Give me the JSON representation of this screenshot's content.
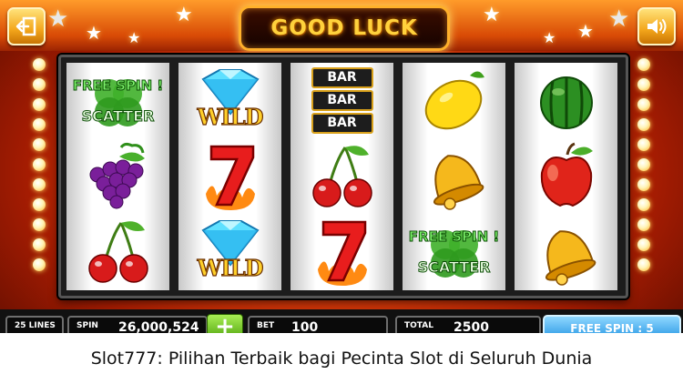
{
  "header": {
    "title": "GOOD LUCK",
    "back_icon": "exit-icon",
    "sound_icon": "speaker-icon"
  },
  "reels": [
    [
      "free-spin-scatter",
      "grapes",
      "cherries"
    ],
    [
      "diamond-wild",
      "seven",
      "diamond-wild"
    ],
    [
      "bar-bar-bar",
      "cherries",
      "seven"
    ],
    [
      "lemon",
      "bell",
      "free-spin-scatter"
    ],
    [
      "watermelon",
      "apple",
      "bell"
    ]
  ],
  "symbols": {
    "free_spin_label": "FREE SPIN !",
    "scatter_label": "SCATTER",
    "wild_label": "WILD",
    "bar_label": "BAR"
  },
  "bottom_bar": {
    "lines": "25 LINES",
    "spin_label": "SPIN",
    "spin_value": "26,000,524",
    "plus_label": "+",
    "bet_label": "BET",
    "bet_value": "100",
    "total_label": "TOTAL",
    "total_value": "2500",
    "free_spin_button": "FREE SPIN : 5"
  },
  "caption": "Slot777: Pilihan Terbaik bagi Pecinta Slot di Seluruh Dunia",
  "colors": {
    "background": "#e0400a",
    "title_gold": "#ffd23c",
    "plus_green": "#4ea20c",
    "spin_blue": "#1b8fe0"
  }
}
